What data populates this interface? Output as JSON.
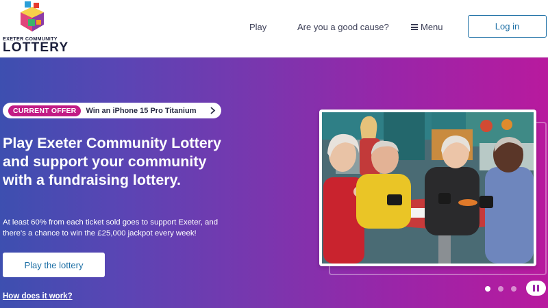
{
  "header": {
    "logo": {
      "top_line": "EXETER COMMUNITY",
      "main": "LOTTERY"
    },
    "nav": {
      "play": "Play",
      "good_cause": "Are you a good cause?",
      "menu": "Menu"
    },
    "login": "Log in"
  },
  "hero": {
    "offer": {
      "tag": "CURRENT OFFER",
      "text": "Win an iPhone 15 Pro Titanium"
    },
    "title": "Play Exeter Community Lottery and support your community with a fundraising lottery.",
    "body": "At least 60% from each ticket sold goes to support Exeter, and there's a chance to win the £25,000 jackpot every week!",
    "cta": "Play the lottery",
    "how_link": "How does it work?"
  },
  "carousel": {
    "slide_count": 3,
    "active_slide": 1
  },
  "colors": {
    "brand_navy": "#1b1f3b",
    "link_blue": "#1d6fa5",
    "offer_magenta": "#c21b85",
    "hero_gradient_start": "#3d4fb0",
    "hero_gradient_end": "#b81a9e"
  }
}
